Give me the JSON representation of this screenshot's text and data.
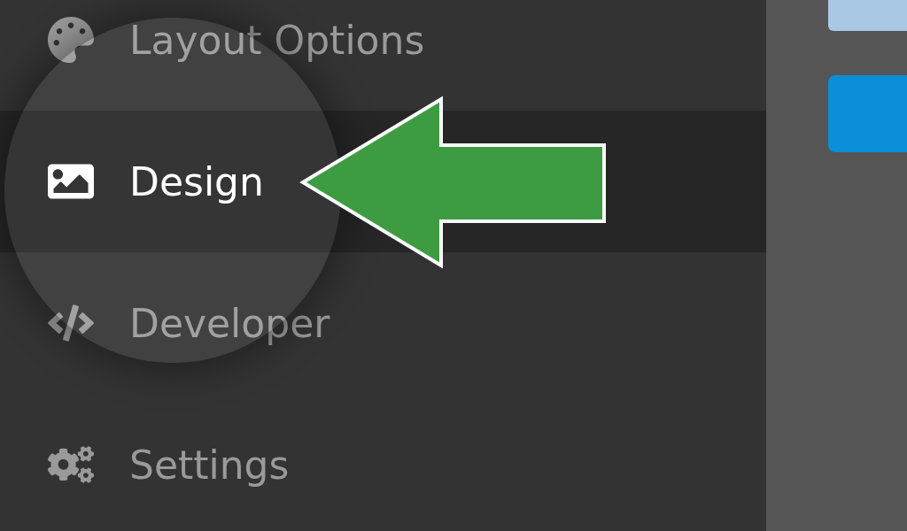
{
  "sidebar": {
    "items": [
      {
        "label": "Layout Options",
        "selected": false
      },
      {
        "label": "Design",
        "selected": true
      },
      {
        "label": "Developer",
        "selected": false
      },
      {
        "label": "Settings",
        "selected": false
      }
    ]
  }
}
